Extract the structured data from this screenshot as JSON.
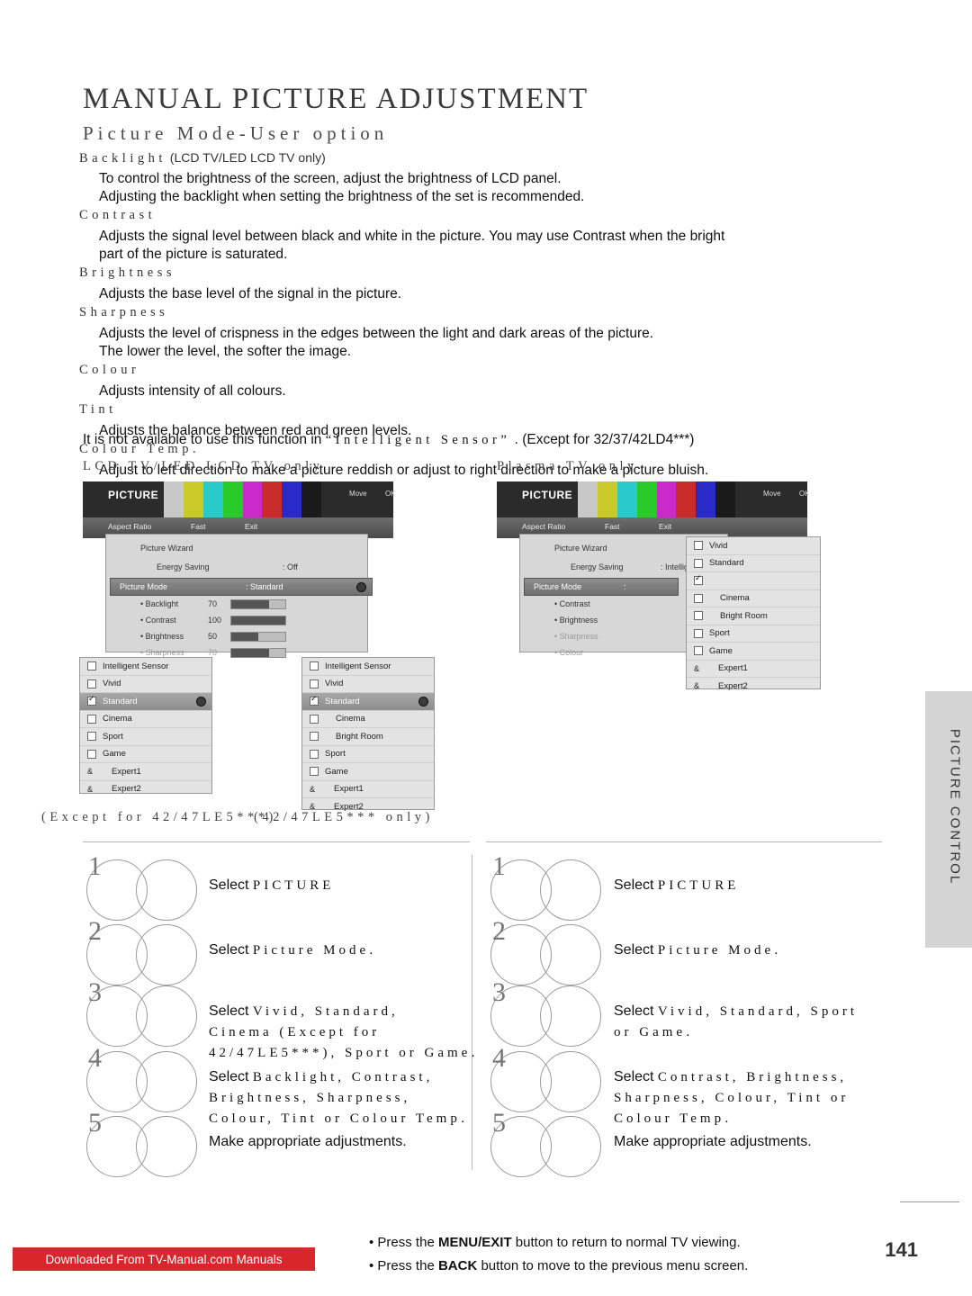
{
  "header": {
    "title": "MANUAL PICTURE ADJUSTMENT",
    "subtitle": "Picture Mode-User option"
  },
  "terms": [
    {
      "name": "Backlight",
      "note": "(LCD TV/LED LCD TV only)",
      "desc": [
        "To control the brightness of the screen, adjust the brightness of LCD panel.",
        "Adjusting the backlight when setting the brightness of the set is recommended."
      ]
    },
    {
      "name": "Contrast",
      "note": "",
      "desc": [
        "Adjusts the signal level between black and white in the picture. You may use Contrast when the bright",
        "part of the picture is saturated."
      ]
    },
    {
      "name": "Brightness",
      "note": "",
      "desc": [
        "Adjusts the base level of the signal in the picture."
      ]
    },
    {
      "name": "Sharpness",
      "note": "",
      "desc": [
        "Adjusts the level of crispness in the edges between the light and dark areas of the picture.",
        "The lower the level, the softer the image."
      ]
    },
    {
      "name": "Colour",
      "note": "",
      "desc": [
        "Adjusts intensity of all colours."
      ]
    },
    {
      "name": "Tint",
      "note": "",
      "desc": [
        "Adjusts the balance between red and green levels."
      ]
    },
    {
      "name": "Colour Temp.",
      "note": "",
      "desc": [
        "Adjust to left direction to make a picture reddish or adjust to right direction to make a picture bluish."
      ]
    }
  ],
  "note_line": {
    "prefix": "It is not available to use this function in",
    "quoted": "“Intelligent Sensor”",
    "suffix": ". (Except for 32/37/42LD4***)"
  },
  "captions": {
    "left": "LCD TV/LED LCD TV only",
    "right": "Plasma TV only",
    "left_bottom": "(Except for 42/47LE5***)",
    "right_bottom": "(42/47LE5*** only)"
  },
  "osd_left": {
    "title": "PICTURE",
    "move": "Move",
    "ok": "OK",
    "toolbar": [
      "Aspect Ratio",
      "Fast",
      "Exit"
    ],
    "rows": [
      {
        "label": "Picture Wizard",
        "value": "",
        "selected": false
      },
      {
        "label": "Energy Saving",
        "value": ": Off",
        "selected": false
      },
      {
        "label": "Picture Mode",
        "value": ": Standard",
        "selected": true
      }
    ],
    "sliders": [
      {
        "label": "• Backlight",
        "value": "70",
        "fill": 70
      },
      {
        "label": "• Contrast",
        "value": "100",
        "fill": 100
      },
      {
        "label": "• Brightness",
        "value": "50",
        "fill": 50
      },
      {
        "label": "• Sharpness",
        "value": "70",
        "fill": 70
      }
    ]
  },
  "osd_right": {
    "title": "PICTURE",
    "move": "Move",
    "ok": "OK",
    "toolbar": [
      "Aspect Ratio",
      "Fast",
      "Exit"
    ],
    "rows": [
      {
        "label": "Picture Wizard",
        "value": "",
        "selected": false
      },
      {
        "label": "Energy Saving",
        "value": ": Intelligent Sensor",
        "selected": false
      },
      {
        "label": "Picture Mode",
        "value": ":",
        "selected": true
      }
    ],
    "items": [
      "• Contrast",
      "• Brightness",
      "• Sharpness",
      "• Colour"
    ]
  },
  "menu_a": {
    "items": [
      {
        "label": "Intelligent Sensor",
        "type": "check",
        "checked": false,
        "highlight": false,
        "indent": false,
        "dot": false
      },
      {
        "label": "Vivid",
        "type": "check",
        "checked": false,
        "highlight": false,
        "indent": false,
        "dot": false
      },
      {
        "label": "Standard",
        "type": "check",
        "checked": true,
        "highlight": true,
        "indent": false,
        "dot": true
      },
      {
        "label": "Cinema",
        "type": "check",
        "checked": false,
        "highlight": false,
        "indent": false,
        "dot": false
      },
      {
        "label": "Sport",
        "type": "check",
        "checked": false,
        "highlight": false,
        "indent": false,
        "dot": false
      },
      {
        "label": "Game",
        "type": "check",
        "checked": false,
        "highlight": false,
        "indent": false,
        "dot": false
      },
      {
        "label": "Expert1",
        "type": "amp",
        "checked": false,
        "highlight": false,
        "indent": true,
        "dot": false
      },
      {
        "label": "Expert2",
        "type": "amp",
        "checked": false,
        "highlight": false,
        "indent": true,
        "dot": false
      }
    ]
  },
  "menu_b": {
    "items": [
      {
        "label": "Intelligent Sensor",
        "type": "check",
        "checked": false,
        "highlight": false,
        "indent": false,
        "dot": false
      },
      {
        "label": "Vivid",
        "type": "check",
        "checked": false,
        "highlight": false,
        "indent": false,
        "dot": false
      },
      {
        "label": "Standard",
        "type": "check",
        "checked": true,
        "highlight": true,
        "indent": false,
        "dot": true
      },
      {
        "label": "Cinema",
        "type": "check",
        "checked": false,
        "highlight": false,
        "indent": true,
        "dot": false
      },
      {
        "label": "Bright Room",
        "type": "check",
        "checked": false,
        "highlight": false,
        "indent": true,
        "dot": false
      },
      {
        "label": "Sport",
        "type": "check",
        "checked": false,
        "highlight": false,
        "indent": false,
        "dot": false
      },
      {
        "label": "Game",
        "type": "check",
        "checked": false,
        "highlight": false,
        "indent": false,
        "dot": false
      },
      {
        "label": "Expert1",
        "type": "amp",
        "checked": false,
        "highlight": false,
        "indent": true,
        "dot": false
      },
      {
        "label": "Expert2",
        "type": "amp",
        "checked": false,
        "highlight": false,
        "indent": true,
        "dot": false
      }
    ]
  },
  "menu_c": {
    "items": [
      {
        "label": "Vivid",
        "type": "check",
        "checked": false,
        "highlight": false,
        "indent": false,
        "dot": false
      },
      {
        "label": "Standard",
        "type": "check",
        "checked": false,
        "highlight": false,
        "indent": false,
        "dot": false
      },
      {
        "label": "",
        "type": "check",
        "checked": true,
        "highlight": false,
        "indent": false,
        "dot": false
      },
      {
        "label": "Cinema",
        "type": "check",
        "checked": false,
        "highlight": false,
        "indent": true,
        "dot": false
      },
      {
        "label": "Bright Room",
        "type": "check",
        "checked": false,
        "highlight": false,
        "indent": true,
        "dot": false
      },
      {
        "label": "Sport",
        "type": "check",
        "checked": false,
        "highlight": false,
        "indent": false,
        "dot": false
      },
      {
        "label": "Game",
        "type": "check",
        "checked": false,
        "highlight": false,
        "indent": false,
        "dot": false
      },
      {
        "label": "Expert1",
        "type": "amp",
        "checked": false,
        "highlight": false,
        "indent": true,
        "dot": false
      },
      {
        "label": "Expert2",
        "type": "amp",
        "checked": false,
        "highlight": false,
        "indent": true,
        "dot": false
      }
    ]
  },
  "steps_left": [
    {
      "num": "1",
      "lines": [
        {
          "plain": "Select ",
          "sp": "PICTURE",
          "tail": ""
        }
      ]
    },
    {
      "num": "2",
      "lines": [
        {
          "plain": "Select ",
          "sp": "Picture Mode",
          "tail": "."
        }
      ]
    },
    {
      "num": "3",
      "lines": [
        {
          "plain": "Select ",
          "sp": "Vivid, Standard,",
          "tail": ""
        },
        {
          "plain": "",
          "sp": "Cinema (Except for",
          "tail": ""
        },
        {
          "plain": "",
          "sp": "42/47LE5***), Sport or Game",
          "tail": "."
        }
      ]
    },
    {
      "num": "4",
      "lines": [
        {
          "plain": "Select ",
          "sp": "Backlight, Contrast,",
          "tail": ""
        },
        {
          "plain": "",
          "sp": "Brightness, Sharpness,",
          "tail": ""
        },
        {
          "plain": "",
          "sp": "Colour, Tint or Colour Temp",
          "tail": "."
        }
      ]
    },
    {
      "num": "5",
      "lines": [
        {
          "plain": "Make appropriate adjustments.",
          "sp": "",
          "tail": ""
        }
      ]
    }
  ],
  "steps_right": [
    {
      "num": "1",
      "lines": [
        {
          "plain": "Select ",
          "sp": "PICTURE",
          "tail": ""
        }
      ]
    },
    {
      "num": "2",
      "lines": [
        {
          "plain": "Select ",
          "sp": "Picture Mode",
          "tail": "."
        }
      ]
    },
    {
      "num": "3",
      "lines": [
        {
          "plain": "Select ",
          "sp": "Vivid, Standard, Sport",
          "tail": ""
        },
        {
          "plain": "",
          "sp": "or Game",
          "tail": "."
        }
      ]
    },
    {
      "num": "4",
      "lines": [
        {
          "plain": "Select ",
          "sp": "Contrast, Brightness,",
          "tail": ""
        },
        {
          "plain": "",
          "sp": "Sharpness, Colour, Tint or",
          "tail": ""
        },
        {
          "plain": "",
          "sp": "Colour Temp",
          "tail": "."
        }
      ]
    },
    {
      "num": "5",
      "lines": [
        {
          "plain": "Make appropriate adjustments.",
          "sp": "",
          "tail": ""
        }
      ]
    }
  ],
  "footer": {
    "note1_pre": "• Press the ",
    "note1_b": "MENU/EXIT",
    "note1_post": " button to return to normal TV viewing.",
    "note2_pre": "• Press the ",
    "note2_b": "BACK",
    "note2_post": " button to move to the previous menu screen.",
    "page_number": "141",
    "download_banner": "Downloaded From TV-Manual.com Manuals"
  },
  "sidetab": {
    "label": "PICTURE CONTROL"
  },
  "colors": {
    "accent_red": "#d9262c",
    "osd_dark": "#2b2b2b",
    "panel_gray": "#d7d7d7"
  }
}
